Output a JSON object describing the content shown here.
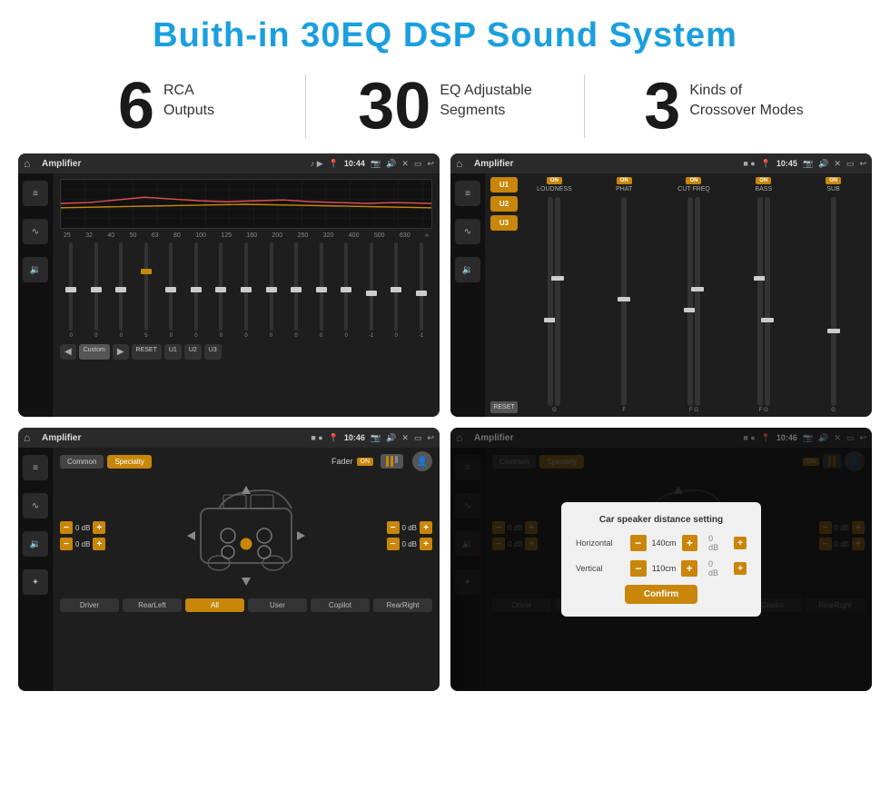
{
  "header": {
    "title": "Buith-in 30EQ DSP Sound System"
  },
  "stats": [
    {
      "number": "6",
      "text": "RCA\nOutputs"
    },
    {
      "number": "30",
      "text": "EQ Adjustable\nSegments"
    },
    {
      "number": "3",
      "text": "Kinds of\nCrossover Modes"
    }
  ],
  "screens": [
    {
      "id": "eq-screen",
      "statusBar": {
        "title": "Amplifier",
        "time": "10:44"
      },
      "type": "eq"
    },
    {
      "id": "crossover-screen",
      "statusBar": {
        "title": "Amplifier",
        "time": "10:45"
      },
      "type": "crossover"
    },
    {
      "id": "fader-screen",
      "statusBar": {
        "title": "Amplifier",
        "time": "10:46"
      },
      "type": "fader"
    },
    {
      "id": "dialog-screen",
      "statusBar": {
        "title": "Amplifier",
        "time": "10:46"
      },
      "type": "dialog"
    }
  ],
  "eq": {
    "freqs": [
      "25",
      "32",
      "40",
      "50",
      "63",
      "80",
      "100",
      "125",
      "160",
      "200",
      "250",
      "320",
      "400",
      "500",
      "630"
    ],
    "values": [
      "0",
      "0",
      "0",
      "5",
      "0",
      "0",
      "0",
      "0",
      "0",
      "0",
      "0",
      "0",
      "-1",
      "0",
      "-1"
    ],
    "bottomBtns": [
      "Custom",
      "RESET",
      "U1",
      "U2",
      "U3"
    ]
  },
  "crossover": {
    "uButtons": [
      "U1",
      "U2",
      "U3"
    ],
    "columns": [
      {
        "onLabel": "ON",
        "label": "LOUDNESS"
      },
      {
        "onLabel": "ON",
        "label": "PHAT"
      },
      {
        "onLabel": "ON",
        "label": "CUT FREQ"
      },
      {
        "onLabel": "ON",
        "label": "BASS"
      },
      {
        "onLabel": "ON",
        "label": "SUB"
      }
    ]
  },
  "fader": {
    "tabs": [
      "Common",
      "Specialty"
    ],
    "activeTab": "Specialty",
    "faderLabel": "Fader",
    "onLabel": "ON",
    "leftControls": [
      {
        "label": "0 dB"
      },
      {
        "label": "0 dB"
      }
    ],
    "rightControls": [
      {
        "label": "0 dB"
      },
      {
        "label": "0 dB"
      }
    ],
    "bottomBtns": [
      "Driver",
      "RearLeft",
      "All",
      "User",
      "Copilot",
      "RearRight"
    ]
  },
  "dialog": {
    "title": "Car speaker distance setting",
    "fields": [
      {
        "label": "Horizontal",
        "value": "140cm"
      },
      {
        "label": "Vertical",
        "value": "110cm"
      }
    ],
    "confirmLabel": "Confirm",
    "rightControls": [
      {
        "label": "0 dB"
      },
      {
        "label": "0 dB"
      }
    ]
  }
}
